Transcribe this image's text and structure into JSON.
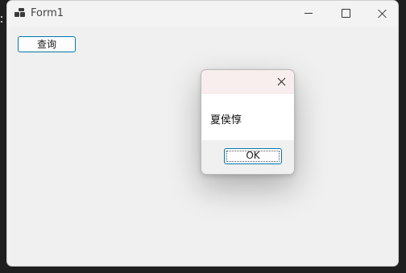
{
  "window": {
    "title": "Form1",
    "icon": "app-icon",
    "controls": {
      "minimize": "minimize-icon",
      "maximize": "maximize-icon",
      "close": "close-icon"
    }
  },
  "main": {
    "query_button_label": "查询"
  },
  "dialog": {
    "message": "夏侯惇",
    "ok_label": "OK",
    "close_icon": "close-icon"
  },
  "colors": {
    "window_bg": "#f0f0f0",
    "button_border": "#0078a8",
    "dialog_title_bg": "#f8eeee"
  }
}
